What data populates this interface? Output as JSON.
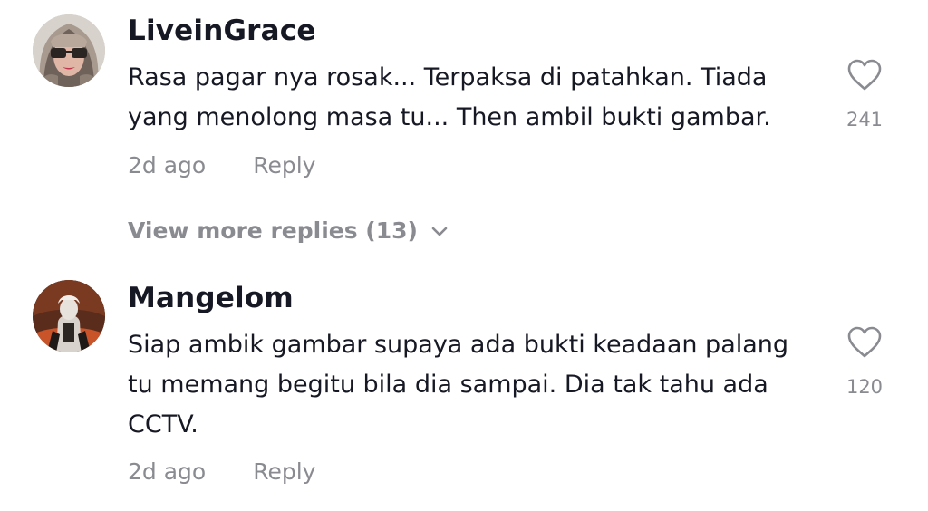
{
  "comments": [
    {
      "username": "LiveinGrace",
      "text": "Rasa pagar nya rosak... Terpaksa di patahkan. Tiada yang menolong masa tu... Then ambil bukti gambar.",
      "time": "2d ago",
      "reply_label": "Reply",
      "likes": "241",
      "avatar_icon": "avatar-woman-sunglasses",
      "like_icon": "heart-outline-icon"
    },
    {
      "username": "Mangelom",
      "text": "Siap ambik gambar supaya ada bukti keadaan palang tu memang begitu bila dia sampai. Dia tak tahu ada CCTV.",
      "time": "2d ago",
      "reply_label": "Reply",
      "likes": "120",
      "avatar_icon": "avatar-warrior",
      "like_icon": "heart-outline-icon"
    }
  ],
  "view_more": {
    "label": "View more replies (13)",
    "icon": "chevron-down-icon"
  },
  "colors": {
    "primary_text": "#161823",
    "secondary_text": "#8a8b91",
    "background": "#ffffff"
  }
}
